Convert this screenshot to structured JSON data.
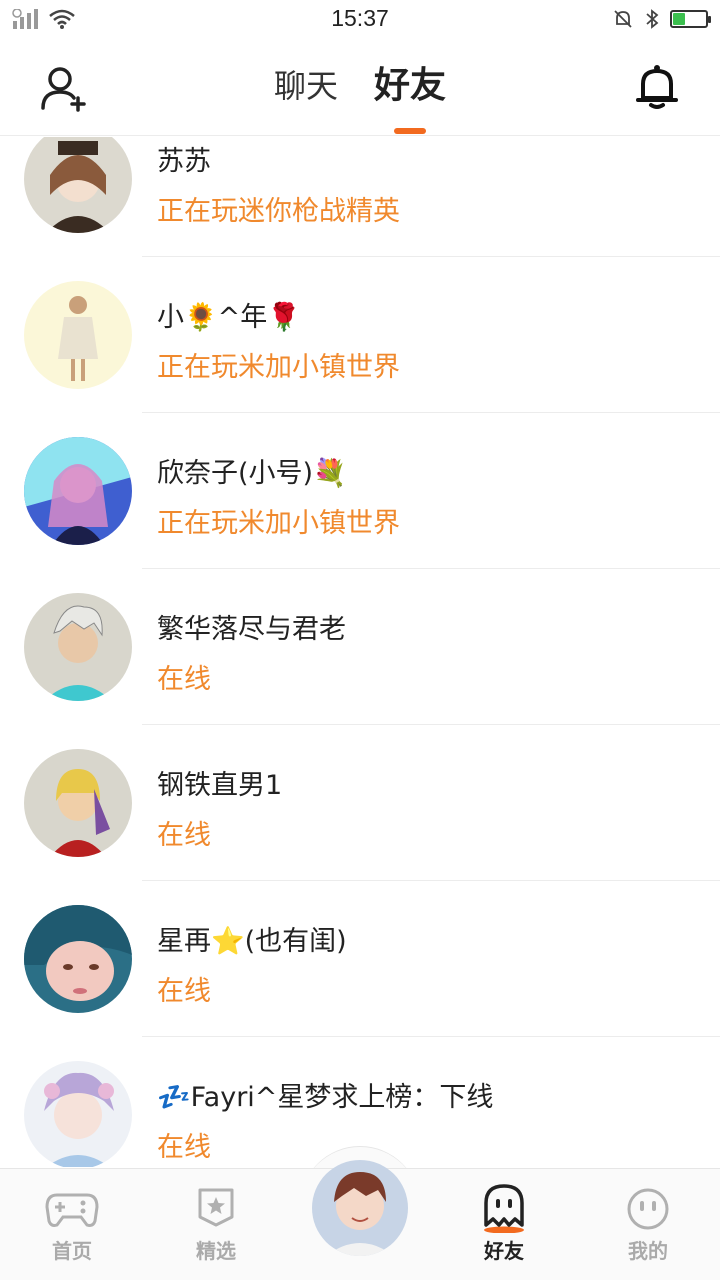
{
  "status_bar": {
    "time": "15:37",
    "battery_level": 0.34
  },
  "header": {
    "tabs": [
      {
        "label": "聊天",
        "active": false
      },
      {
        "label": "好友",
        "active": true
      }
    ],
    "accent_color": "#f26a1f"
  },
  "friends": [
    {
      "name": "苏苏",
      "status": "正在玩迷你枪战精英"
    },
    {
      "name": "小🌻^年🌹",
      "status": "正在玩米加小镇世界"
    },
    {
      "name": "欣奈子(小号)💐",
      "status": "正在玩米加小镇世界"
    },
    {
      "name": "繁华落尽与君老",
      "status": "在线"
    },
    {
      "name": "钢铁直男1",
      "status": "在线"
    },
    {
      "name": "星再⭐(也有闺)",
      "status": "在线"
    },
    {
      "name": "💤Fayri^星梦求上榜：下线",
      "status": "在线"
    }
  ],
  "status_color": "#f0892d",
  "bottom_nav": {
    "items": [
      {
        "label": "首页",
        "icon": "gamepad-icon",
        "active": false
      },
      {
        "label": "精选",
        "icon": "star-badge-icon",
        "active": false
      },
      {
        "label": "好友",
        "icon": "ghost-icon",
        "active": true
      },
      {
        "label": "我的",
        "icon": "face-icon",
        "active": false
      }
    ]
  }
}
